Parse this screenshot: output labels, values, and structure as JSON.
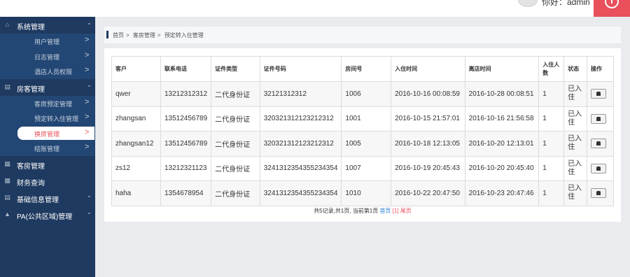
{
  "header": {
    "greeting": "你好：admin",
    "accent_color": "#e8505b",
    "power_icon": "power-icon"
  },
  "sidebar": {
    "groups": [
      {
        "icon": "home-icon",
        "label": "系统管理",
        "expanded": true,
        "items": [
          "用户管理",
          "日志管理",
          "酒店人员权限"
        ]
      },
      {
        "icon": "list-icon",
        "label": "房客管理",
        "expanded": true,
        "items": [
          "客房预定管理",
          "预定转入住管理",
          "换房管理",
          "结账管理"
        ],
        "active_item": "换房管理"
      },
      {
        "icon": "grid-icon",
        "label": "客房管理"
      },
      {
        "icon": "chart-icon",
        "label": "财务查询"
      },
      {
        "icon": "bars-icon",
        "label": "基础信息管理",
        "expanded": false
      },
      {
        "icon": "warning-icon",
        "label": "PA(公共区域)管理",
        "expanded": false
      }
    ]
  },
  "breadcrumb": [
    "首页",
    "客房管理",
    "预定转入住管理"
  ],
  "table": {
    "columns": [
      "客户",
      "联系电话",
      "证件类型",
      "证件号码",
      "房间号",
      "入住时间",
      "离店时间",
      "入住人数",
      "状态",
      "操作"
    ],
    "rows": [
      [
        "qwer",
        "13212312312",
        "二代身份证",
        "32121312312",
        "1006",
        "2016-10-16 00:08:59",
        "2016-10-28 00:08:51",
        "1",
        "已入住"
      ],
      [
        "zhangsan",
        "13512456789",
        "二代身份证",
        "320321312123212312",
        "1001",
        "2016-10-15 21:57:01",
        "2016-10-16 21:56:58",
        "1",
        "已入住"
      ],
      [
        "zhangsan12",
        "13512456789",
        "二代身份证",
        "320321312123212312",
        "1005",
        "2016-10-18 12:13:05",
        "2016-10-20 12:13:01",
        "1",
        "已入住"
      ],
      [
        "zs12",
        "13212321123",
        "二代身份证",
        "3241312354355234354",
        "1007",
        "2016-10-19 20:45:43",
        "2016-10-20 20:45:40",
        "1",
        "已入住"
      ],
      [
        "haha",
        "1354678954",
        "二代身份证",
        "3241312354355234354",
        "1010",
        "2016-10-22 20:47:50",
        "2016-10-23 20:47:46",
        "1",
        "已入住"
      ]
    ]
  },
  "pager": {
    "summary": "共5记录,共1页, 当前第1页",
    "first": "首页",
    "current": "[1]",
    "last": "尾页"
  }
}
